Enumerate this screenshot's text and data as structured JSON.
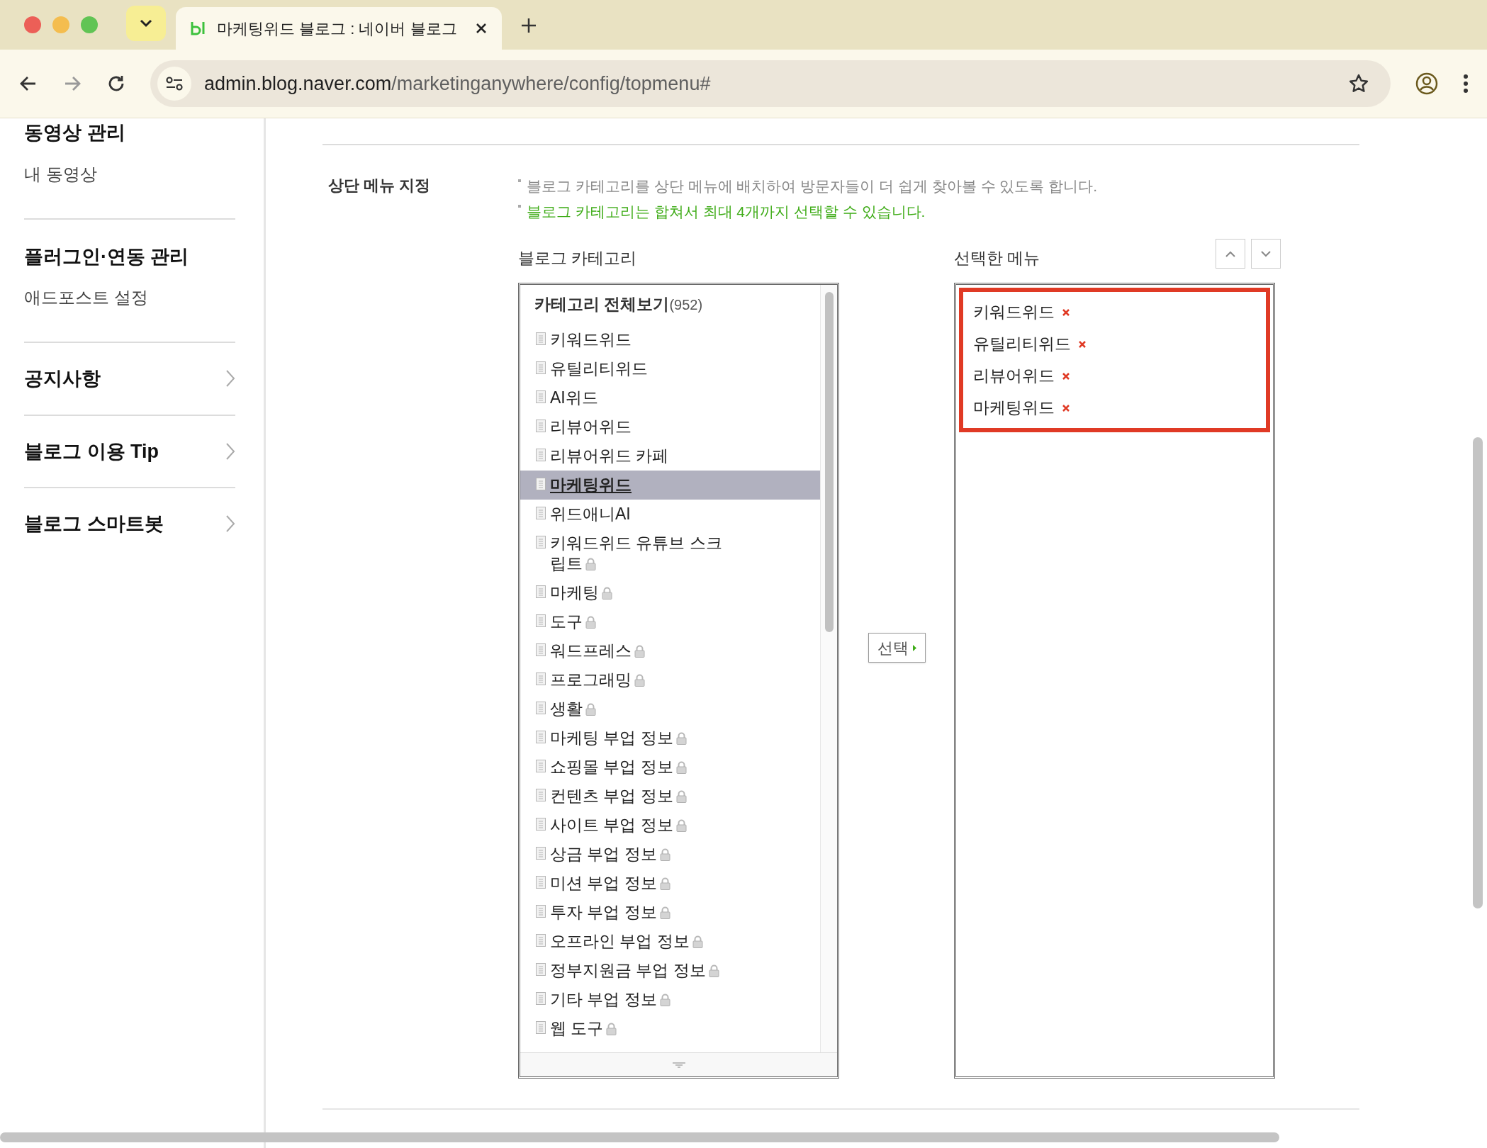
{
  "browser": {
    "tab_title": "마케팅위드 블로그 : 네이버 블로그",
    "url_host": "admin.blog.naver.com",
    "url_path": "/marketinganywhere/config/topmenu#"
  },
  "sidebar": [
    {
      "title": "동영상 관리",
      "links": [
        "내 동영상"
      ],
      "arrow": false
    },
    {
      "title": "플러그인·연동 관리",
      "links": [
        "애드포스트 설정"
      ],
      "arrow": false
    },
    {
      "title": "공지사항",
      "arrow": true
    },
    {
      "title": "블로그 이용 Tip",
      "arrow": true
    },
    {
      "title": "블로그 스마트봇",
      "arrow": true
    }
  ],
  "section_label": "상단 메뉴 지정",
  "notes": [
    {
      "text": "블로그 카테고리를 상단 메뉴에 배치하여 방문자들이 더 쉽게 찾아볼 수 있도록 합니다.",
      "kind": "info"
    },
    {
      "text": "블로그 카테고리는 합쳐서 최대 4개까지 선택할 수 있습니다.",
      "kind": "highlight"
    }
  ],
  "categories": {
    "label": "블로그 카테고리",
    "header": "카테고리 전체보기",
    "count": "(952)",
    "items": [
      {
        "label": "키워드위드",
        "locked": false,
        "selected": false
      },
      {
        "label": "유틸리티위드",
        "locked": false,
        "selected": false
      },
      {
        "label": "AI위드",
        "locked": false,
        "selected": false
      },
      {
        "label": "리뷰어위드",
        "locked": false,
        "selected": false
      },
      {
        "label": "리뷰어위드 카페",
        "locked": false,
        "selected": false
      },
      {
        "label": "마케팅위드",
        "locked": false,
        "selected": true
      },
      {
        "label": "위드애니AI",
        "locked": false,
        "selected": false
      },
      {
        "label": "키워드위드 유튜브 스크립트",
        "locked": true,
        "selected": false
      },
      {
        "label": "마케팅",
        "locked": true,
        "selected": false
      },
      {
        "label": "도구",
        "locked": true,
        "selected": false
      },
      {
        "label": "워드프레스",
        "locked": true,
        "selected": false
      },
      {
        "label": "프로그래밍",
        "locked": true,
        "selected": false
      },
      {
        "label": "생활",
        "locked": true,
        "selected": false
      },
      {
        "label": "마케팅 부업 정보",
        "locked": true,
        "selected": false
      },
      {
        "label": "쇼핑몰 부업 정보",
        "locked": true,
        "selected": false
      },
      {
        "label": "컨텐츠 부업 정보",
        "locked": true,
        "selected": false
      },
      {
        "label": "사이트 부업 정보",
        "locked": true,
        "selected": false
      },
      {
        "label": "상금 부업 정보",
        "locked": true,
        "selected": false
      },
      {
        "label": "미션 부업 정보",
        "locked": true,
        "selected": false
      },
      {
        "label": "투자 부업 정보",
        "locked": true,
        "selected": false
      },
      {
        "label": "오프라인 부업 정보",
        "locked": true,
        "selected": false
      },
      {
        "label": "정부지원금 부업 정보",
        "locked": true,
        "selected": false
      },
      {
        "label": "기타 부업 정보",
        "locked": true,
        "selected": false
      },
      {
        "label": "웹 도구",
        "locked": true,
        "selected": false
      }
    ]
  },
  "select_button": "선택",
  "selected_menu": {
    "label": "선택한 메뉴",
    "items": [
      "키워드위드",
      "유틸리티위드",
      "리뷰어위드",
      "마케팅위드"
    ]
  }
}
